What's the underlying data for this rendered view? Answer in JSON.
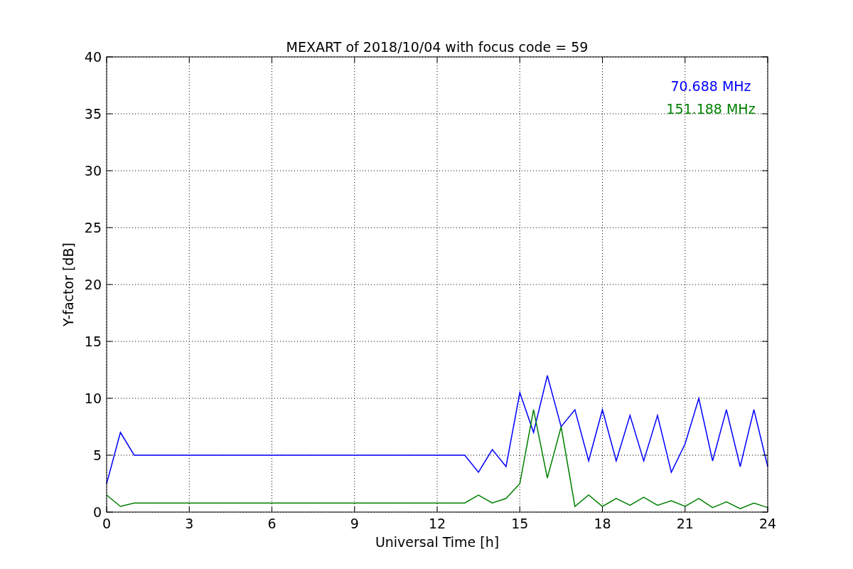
{
  "chart_data": {
    "type": "line",
    "title": "MEXART of 2018/10/04 with focus code = 59",
    "xlabel": "Universal Time [h]",
    "ylabel": "Y-factor [dB]",
    "x": [
      0,
      0.5,
      1,
      1.5,
      2,
      2.5,
      3,
      3.5,
      4,
      4.5,
      5,
      5.5,
      6,
      6.5,
      7,
      7.5,
      8,
      8.5,
      9,
      9.5,
      10,
      10.5,
      11,
      11.5,
      12,
      12.5,
      13,
      13.5,
      14,
      14.5,
      15,
      15.5,
      16,
      16.5,
      17,
      17.5,
      18,
      18.5,
      19,
      19.5,
      20,
      20.5,
      21,
      21.5,
      22,
      22.5,
      23,
      23.5,
      24
    ],
    "series": [
      {
        "name": "70.688 MHz",
        "color": "#0000ff",
        "values": [
          2.5,
          7,
          5,
          5,
          5,
          5,
          5,
          5,
          5,
          5,
          5,
          5,
          5,
          5,
          5,
          5,
          5,
          5,
          5,
          5,
          5,
          5,
          5,
          5,
          5,
          5,
          5,
          3.5,
          5.5,
          4,
          10.5,
          7,
          12,
          7.5,
          9,
          4.5,
          9,
          4.5,
          8.5,
          4.5,
          8.5,
          3.5,
          6,
          10,
          4.5,
          9,
          4,
          9,
          4
        ]
      },
      {
        "name": "151.188 MHz",
        "color": "#008000",
        "values": [
          1.5,
          0.5,
          0.8,
          0.8,
          0.8,
          0.8,
          0.8,
          0.8,
          0.8,
          0.8,
          0.8,
          0.8,
          0.8,
          0.8,
          0.8,
          0.8,
          0.8,
          0.8,
          0.8,
          0.8,
          0.8,
          0.8,
          0.8,
          0.8,
          0.8,
          0.8,
          0.8,
          1.5,
          0.8,
          1.2,
          2.5,
          9,
          3,
          7.5,
          0.5,
          1.5,
          0.5,
          1.2,
          0.6,
          1.3,
          0.6,
          1,
          0.5,
          1.2,
          0.4,
          0.9,
          0.3,
          0.8,
          0.4
        ]
      }
    ],
    "grid": true,
    "xlim": [
      0,
      24
    ],
    "ylim": [
      0,
      40
    ],
    "xticks": [
      0,
      3,
      6,
      9,
      12,
      15,
      18,
      21,
      24
    ],
    "yticks": [
      0,
      5,
      10,
      15,
      20,
      25,
      30,
      35,
      40
    ]
  }
}
